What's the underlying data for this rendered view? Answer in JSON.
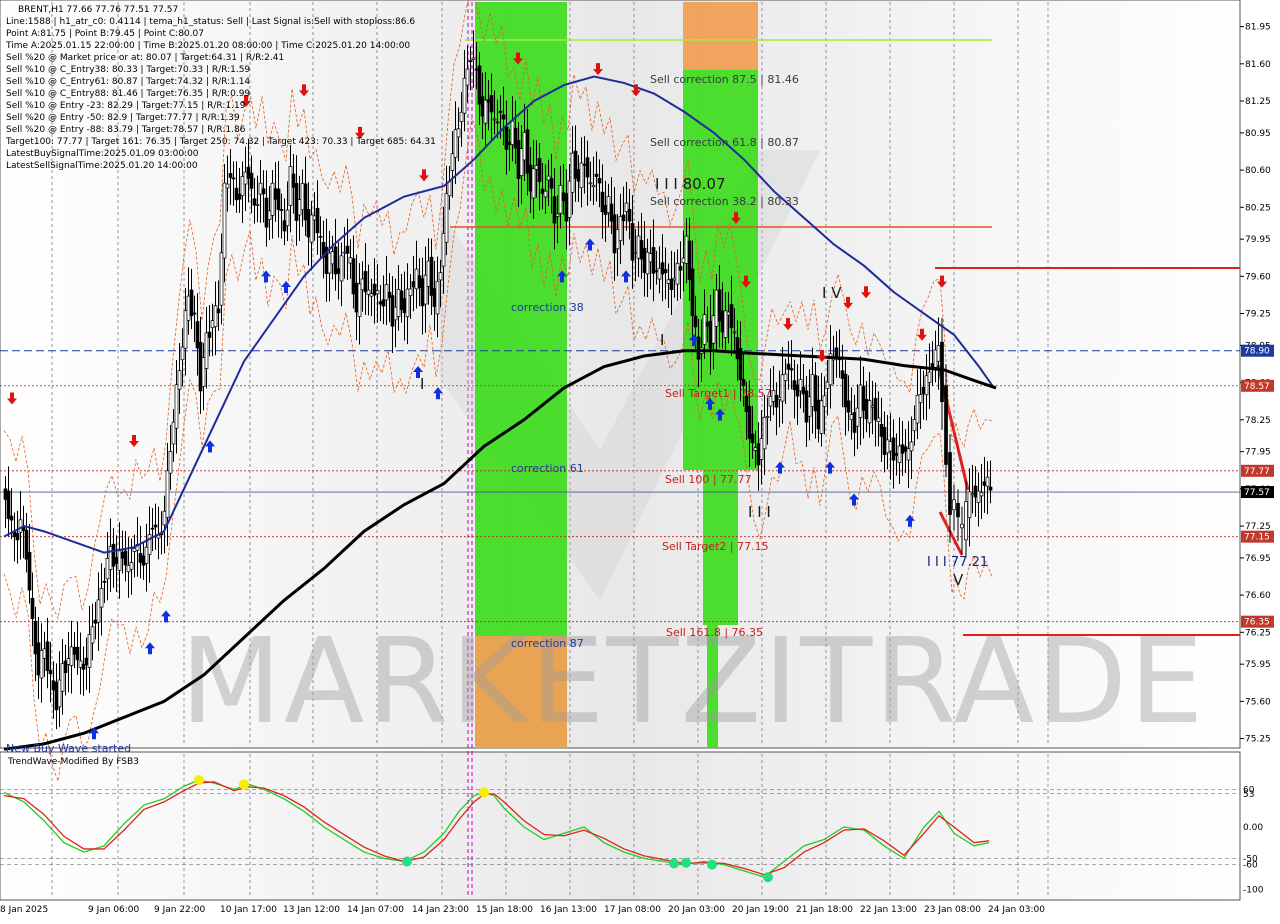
{
  "header": {
    "title": "BRENT,H1  77.66 77.76 77.51 77.57",
    "lines": [
      "Line:1588  |  h1_atr_c0: 0.4114  |  tema_h1_status: Sell  |  Last Signal is:Sell with stoploss:86.6",
      "Point A:81.75  |  Point B:79.45  |  Point C:80.07",
      "Time A:2025.01.15 22:00:00  |  Time B:2025.01.20 08:00:00  |  Time C:2025.01.20 14:00:00",
      "Sell %20 @ Market price or at: 80.07  |  Target:64.31  |  R/R:2.41",
      "Sell %10 @ C_Entry38: 80.33  |  Target:70.33  |  R/R:1.59",
      "Sell %10 @ C_Entry61: 80.87  |  Target:74.32  |  R/R:1.14",
      "Sell %10 @ C_Entry88: 81.46  |  Target:76.35  |  R/R:0.99",
      "Sell %10 @ Entry -23: 82.29  |  Target:77.15  |  R/R:1.19",
      "Sell %20 @ Entry -50: 82.9  |  Target:77.77  |  R/R:1.39",
      "Sell %20 @ Entry -88: 83.79  |  Target:78.57  |  R/R:1.86",
      "Target100: 77.77  |  Target 161: 76.35  |  Target 250: 74.32  |  Target 423: 70.33  |  Target 685: 64.31",
      "LatestBuySignalTime:2025.01.09 03:00:00",
      "LatestSellSignalTime:2025.01.20 14:00:00"
    ]
  },
  "annotations": {
    "sell_corr_875": "Sell correction 87.5 | 81.46",
    "sell_corr_618": "Sell correction 61.8 | 80.87",
    "sell_corr_382": "Sell correction 38.2 | 80.33",
    "point_c_label": "I I I 80.07",
    "correction_38": "correction 38",
    "correction_61": "correction 61",
    "correction_87": "correction 87",
    "sell_target1": "Sell Target1 | 78.57",
    "sell_100": "Sell 100 | 77.77",
    "sell_target2": "Sell Target2 | 77.15",
    "sell_1618": "Sell 161.8 | 76.35",
    "wave_iv": "I V",
    "wave_iii": "I I I",
    "wave_i": "I",
    "wave_i2": "I",
    "wave_iii_value": "I I I 77.21",
    "wave_v": "V",
    "new_label": "New Buy Wave started",
    "watermark": "MARKETZITRADE"
  },
  "oscillator": {
    "title": "TrendWave-Modified By FSB3",
    "ticks": [
      "60",
      "53",
      "0.00",
      "-50",
      "-60",
      "-100"
    ]
  },
  "price_badges": [
    {
      "label": "78.90",
      "value": 78.9,
      "color": "#1f3a9e"
    },
    {
      "label": "78.57",
      "value": 78.57,
      "color": "#c0392b"
    },
    {
      "label": "77.77",
      "value": 77.77,
      "color": "#c0392b"
    },
    {
      "label": "77.57",
      "value": 77.57,
      "color": "#000000"
    },
    {
      "label": "77.15",
      "value": 77.15,
      "color": "#c0392b"
    },
    {
      "label": "76.35",
      "value": 76.35,
      "color": "#c0392b"
    }
  ],
  "colors": {
    "bull_zone": "#3ddc1e",
    "bear_zone": "#f0a055",
    "ma_fast": "#1f2b99",
    "ma_slow": "#000000",
    "target_line": "#c42020",
    "osc_green": "#22cc22",
    "osc_red": "#e02020"
  },
  "chart_data": {
    "type": "candlestick",
    "symbol": "BRENT",
    "timeframe": "H1",
    "ohlc_last": {
      "open": 77.66,
      "high": 77.76,
      "low": 77.51,
      "close": 77.57
    },
    "ylim": [
      75.2,
      81.98
    ],
    "y_ticks": [
      "81.95",
      "81.60",
      "81.25",
      "80.95",
      "80.60",
      "80.25",
      "79.95",
      "79.60",
      "79.25",
      "78.95",
      "78.60",
      "78.25",
      "77.95",
      "77.60",
      "77.25",
      "76.95",
      "76.60",
      "76.25",
      "75.95",
      "75.60",
      "75.25"
    ],
    "x_ticks": [
      "8 Jan 2025",
      "9 Jan 06:00",
      "9 Jan 22:00",
      "10 Jan 17:00",
      "13 Jan 12:00",
      "14 Jan 07:00",
      "14 Jan 23:00",
      "15 Jan 18:00",
      "16 Jan 13:00",
      "17 Jan 08:00",
      "20 Jan 03:00",
      "20 Jan 19:00",
      "21 Jan 18:00",
      "22 Jan 13:00",
      "23 Jan 08:00",
      "24 Jan 03:00"
    ],
    "levels": {
      "sell_correction_875": 81.46,
      "sell_correction_618": 80.87,
      "sell_correction_382": 80.33,
      "point_c": 80.07,
      "point_a": 81.75,
      "point_b": 79.45,
      "sell_target1": 78.57,
      "sell_100": 77.77,
      "sell_target2": 77.15,
      "sell_1618": 76.35,
      "current": 77.57,
      "line_7890": 78.9
    },
    "close_path": [
      [
        0,
        77.6
      ],
      [
        6,
        77.4
      ],
      [
        12,
        77.1
      ],
      [
        18,
        77.3
      ],
      [
        24,
        77.0
      ],
      [
        30,
        76.3
      ],
      [
        36,
        75.9
      ],
      [
        42,
        76.1
      ],
      [
        48,
        75.8
      ],
      [
        54,
        75.6
      ],
      [
        60,
        75.9
      ],
      [
        66,
        76.0
      ],
      [
        72,
        76.1
      ],
      [
        78,
        75.9
      ],
      [
        84,
        76.0
      ],
      [
        90,
        76.3
      ],
      [
        96,
        76.5
      ],
      [
        102,
        76.8
      ],
      [
        108,
        77.0
      ],
      [
        114,
        76.9
      ],
      [
        120,
        77.0
      ],
      [
        126,
        76.8
      ],
      [
        132,
        77.1
      ],
      [
        138,
        76.9
      ],
      [
        144,
        77.0
      ],
      [
        150,
        77.3
      ],
      [
        156,
        77.1
      ],
      [
        162,
        77.4
      ],
      [
        168,
        78.0
      ],
      [
        174,
        78.5
      ],
      [
        180,
        79.0
      ],
      [
        186,
        79.4
      ],
      [
        192,
        79.2
      ],
      [
        198,
        78.6
      ],
      [
        204,
        79.0
      ],
      [
        210,
        79.2
      ],
      [
        216,
        79.3
      ],
      [
        222,
        80.4
      ],
      [
        228,
        80.6
      ],
      [
        234,
        80.3
      ],
      [
        240,
        80.5
      ],
      [
        246,
        80.6
      ],
      [
        252,
        80.2
      ],
      [
        258,
        80.5
      ],
      [
        264,
        80.1
      ],
      [
        270,
        80.4
      ],
      [
        276,
        80.3
      ],
      [
        282,
        80.0
      ],
      [
        288,
        80.6
      ],
      [
        294,
        80.2
      ],
      [
        300,
        80.4
      ],
      [
        306,
        80.0
      ],
      [
        312,
        80.2
      ],
      [
        318,
        79.9
      ],
      [
        324,
        79.7
      ],
      [
        330,
        79.8
      ],
      [
        336,
        79.6
      ],
      [
        342,
        79.9
      ],
      [
        348,
        79.7
      ],
      [
        354,
        79.3
      ],
      [
        360,
        79.6
      ],
      [
        366,
        79.4
      ],
      [
        372,
        79.5
      ],
      [
        378,
        79.3
      ],
      [
        384,
        79.5
      ],
      [
        390,
        79.2
      ],
      [
        396,
        79.4
      ],
      [
        402,
        79.3
      ],
      [
        408,
        79.5
      ],
      [
        414,
        79.6
      ],
      [
        420,
        79.4
      ],
      [
        426,
        79.7
      ],
      [
        432,
        79.3
      ],
      [
        438,
        79.7
      ],
      [
        444,
        80.3
      ],
      [
        450,
        80.8
      ],
      [
        456,
        81.0
      ],
      [
        462,
        81.4
      ],
      [
        468,
        81.7
      ],
      [
        474,
        81.5
      ],
      [
        480,
        81.1
      ],
      [
        486,
        81.3
      ],
      [
        492,
        81.0
      ],
      [
        498,
        81.2
      ],
      [
        504,
        80.8
      ],
      [
        510,
        81.0
      ],
      [
        516,
        80.6
      ],
      [
        522,
        80.9
      ],
      [
        528,
        80.4
      ],
      [
        534,
        80.7
      ],
      [
        540,
        80.3
      ],
      [
        546,
        80.6
      ],
      [
        552,
        80.1
      ],
      [
        558,
        80.4
      ],
      [
        564,
        80.2
      ],
      [
        570,
        80.7
      ],
      [
        576,
        80.5
      ],
      [
        582,
        80.7
      ],
      [
        588,
        80.4
      ],
      [
        594,
        80.6
      ],
      [
        600,
        80.2
      ],
      [
        606,
        80.3
      ],
      [
        612,
        79.9
      ],
      [
        618,
        80.1
      ],
      [
        624,
        80.3
      ],
      [
        630,
        79.8
      ],
      [
        636,
        79.9
      ],
      [
        642,
        79.7
      ],
      [
        648,
        79.8
      ],
      [
        654,
        79.6
      ],
      [
        660,
        79.7
      ],
      [
        666,
        79.5
      ],
      [
        672,
        79.6
      ],
      [
        678,
        79.7
      ],
      [
        684,
        79.9
      ],
      [
        690,
        79.3
      ],
      [
        696,
        78.8
      ],
      [
        702,
        79.2
      ],
      [
        708,
        79.0
      ],
      [
        714,
        79.4
      ],
      [
        720,
        79.1
      ],
      [
        726,
        79.3
      ],
      [
        732,
        79.0
      ],
      [
        738,
        78.7
      ],
      [
        744,
        78.3
      ],
      [
        750,
        78.0
      ],
      [
        756,
        77.9
      ],
      [
        762,
        78.2
      ],
      [
        768,
        78.5
      ],
      [
        774,
        78.4
      ],
      [
        780,
        78.6
      ],
      [
        786,
        78.8
      ],
      [
        792,
        78.5
      ],
      [
        798,
        78.6
      ],
      [
        804,
        78.3
      ],
      [
        810,
        78.6
      ],
      [
        816,
        78.2
      ],
      [
        822,
        78.5
      ],
      [
        828,
        78.8
      ],
      [
        834,
        78.9
      ],
      [
        840,
        78.6
      ],
      [
        846,
        78.3
      ],
      [
        852,
        78.2
      ],
      [
        858,
        78.5
      ],
      [
        864,
        78.3
      ],
      [
        870,
        78.4
      ],
      [
        876,
        78.2
      ],
      [
        882,
        78.0
      ],
      [
        888,
        78.0
      ],
      [
        894,
        77.9
      ],
      [
        900,
        78.0
      ],
      [
        906,
        77.9
      ],
      [
        912,
        78.3
      ],
      [
        918,
        78.5
      ],
      [
        924,
        78.6
      ],
      [
        930,
        78.8
      ],
      [
        936,
        78.9
      ],
      [
        940,
        78.5
      ],
      [
        944,
        77.9
      ],
      [
        948,
        77.4
      ],
      [
        952,
        77.5
      ],
      [
        956,
        77.3
      ],
      [
        960,
        77.2
      ],
      [
        964,
        77.4
      ],
      [
        970,
        77.6
      ],
      [
        976,
        77.5
      ],
      [
        982,
        77.7
      ],
      [
        988,
        77.57
      ]
    ],
    "ma_fast_path": [
      [
        0,
        77.15
      ],
      [
        20,
        77.25
      ],
      [
        40,
        77.2
      ],
      [
        70,
        77.1
      ],
      [
        100,
        77.0
      ],
      [
        130,
        77.05
      ],
      [
        160,
        77.2
      ],
      [
        180,
        77.6
      ],
      [
        200,
        78.0
      ],
      [
        220,
        78.4
      ],
      [
        240,
        78.8
      ],
      [
        270,
        79.2
      ],
      [
        300,
        79.6
      ],
      [
        330,
        79.9
      ],
      [
        360,
        80.15
      ],
      [
        400,
        80.35
      ],
      [
        440,
        80.45
      ],
      [
        470,
        80.7
      ],
      [
        500,
        81.0
      ],
      [
        530,
        81.25
      ],
      [
        560,
        81.4
      ],
      [
        590,
        81.48
      ],
      [
        620,
        81.42
      ],
      [
        650,
        81.32
      ],
      [
        680,
        81.15
      ],
      [
        710,
        80.95
      ],
      [
        740,
        80.7
      ],
      [
        770,
        80.4
      ],
      [
        800,
        80.15
      ],
      [
        830,
        79.9
      ],
      [
        860,
        79.7
      ],
      [
        890,
        79.45
      ],
      [
        920,
        79.25
      ],
      [
        950,
        79.05
      ],
      [
        975,
        78.75
      ],
      [
        990,
        78.55
      ]
    ],
    "ma_slow_path": [
      [
        0,
        75.15
      ],
      [
        40,
        75.2
      ],
      [
        80,
        75.3
      ],
      [
        120,
        75.45
      ],
      [
        160,
        75.6
      ],
      [
        200,
        75.85
      ],
      [
        240,
        76.2
      ],
      [
        280,
        76.55
      ],
      [
        320,
        76.85
      ],
      [
        360,
        77.2
      ],
      [
        400,
        77.45
      ],
      [
        440,
        77.65
      ],
      [
        480,
        78.0
      ],
      [
        520,
        78.25
      ],
      [
        560,
        78.55
      ],
      [
        600,
        78.75
      ],
      [
        640,
        78.85
      ],
      [
        680,
        78.9
      ],
      [
        710,
        78.9
      ],
      [
        740,
        78.88
      ],
      [
        780,
        78.86
      ],
      [
        820,
        78.84
      ],
      [
        860,
        78.82
      ],
      [
        900,
        78.76
      ],
      [
        940,
        78.72
      ],
      [
        970,
        78.62
      ],
      [
        992,
        78.55
      ]
    ],
    "oscillator": {
      "ylim": [
        -110,
        110
      ],
      "green_path": [
        [
          0,
          55
        ],
        [
          20,
          40
        ],
        [
          40,
          10
        ],
        [
          60,
          -25
        ],
        [
          80,
          -40
        ],
        [
          100,
          -30
        ],
        [
          120,
          5
        ],
        [
          140,
          35
        ],
        [
          160,
          45
        ],
        [
          180,
          65
        ],
        [
          195,
          75
        ],
        [
          210,
          70
        ],
        [
          230,
          60
        ],
        [
          245,
          68
        ],
        [
          260,
          60
        ],
        [
          280,
          45
        ],
        [
          300,
          25
        ],
        [
          320,
          0
        ],
        [
          340,
          -20
        ],
        [
          360,
          -40
        ],
        [
          380,
          -50
        ],
        [
          400,
          -55
        ],
        [
          420,
          -40
        ],
        [
          440,
          -10
        ],
        [
          455,
          25
        ],
        [
          470,
          50
        ],
        [
          480,
          55
        ],
        [
          490,
          50
        ],
        [
          500,
          30
        ],
        [
          520,
          0
        ],
        [
          540,
          -20
        ],
        [
          560,
          -10
        ],
        [
          580,
          0
        ],
        [
          600,
          -25
        ],
        [
          620,
          -40
        ],
        [
          640,
          -50
        ],
        [
          660,
          -55
        ],
        [
          680,
          -60
        ],
        [
          700,
          -55
        ],
        [
          720,
          -60
        ],
        [
          740,
          -70
        ],
        [
          760,
          -80
        ],
        [
          780,
          -55
        ],
        [
          800,
          -30
        ],
        [
          820,
          -20
        ],
        [
          840,
          0
        ],
        [
          860,
          -5
        ],
        [
          880,
          -30
        ],
        [
          900,
          -50
        ],
        [
          920,
          0
        ],
        [
          935,
          25
        ],
        [
          950,
          -10
        ],
        [
          970,
          -30
        ],
        [
          985,
          -25
        ]
      ],
      "red_path": [
        [
          0,
          50
        ],
        [
          20,
          45
        ],
        [
          40,
          20
        ],
        [
          60,
          -15
        ],
        [
          80,
          -35
        ],
        [
          100,
          -35
        ],
        [
          120,
          -5
        ],
        [
          140,
          28
        ],
        [
          160,
          40
        ],
        [
          180,
          58
        ],
        [
          195,
          70
        ],
        [
          210,
          72
        ],
        [
          230,
          58
        ],
        [
          245,
          64
        ],
        [
          260,
          62
        ],
        [
          280,
          50
        ],
        [
          300,
          32
        ],
        [
          320,
          8
        ],
        [
          340,
          -12
        ],
        [
          360,
          -32
        ],
        [
          380,
          -46
        ],
        [
          400,
          -55
        ],
        [
          420,
          -48
        ],
        [
          440,
          -20
        ],
        [
          455,
          12
        ],
        [
          470,
          40
        ],
        [
          480,
          52
        ],
        [
          490,
          53
        ],
        [
          500,
          40
        ],
        [
          520,
          10
        ],
        [
          540,
          -12
        ],
        [
          560,
          -14
        ],
        [
          580,
          -5
        ],
        [
          600,
          -18
        ],
        [
          620,
          -35
        ],
        [
          640,
          -46
        ],
        [
          660,
          -52
        ],
        [
          680,
          -58
        ],
        [
          700,
          -57
        ],
        [
          720,
          -58
        ],
        [
          740,
          -66
        ],
        [
          760,
          -76
        ],
        [
          780,
          -65
        ],
        [
          800,
          -40
        ],
        [
          820,
          -25
        ],
        [
          840,
          -5
        ],
        [
          860,
          -3
        ],
        [
          880,
          -22
        ],
        [
          900,
          -45
        ],
        [
          920,
          -10
        ],
        [
          935,
          18
        ],
        [
          950,
          0
        ],
        [
          970,
          -25
        ],
        [
          985,
          -22
        ]
      ],
      "yellow_dots": [
        [
          195,
          75
        ],
        [
          240,
          68
        ],
        [
          480,
          55
        ]
      ],
      "green_dots": [
        [
          403,
          -55
        ],
        [
          670,
          -58
        ],
        [
          682,
          -57
        ],
        [
          708,
          -60
        ],
        [
          764,
          -80
        ]
      ]
    }
  }
}
